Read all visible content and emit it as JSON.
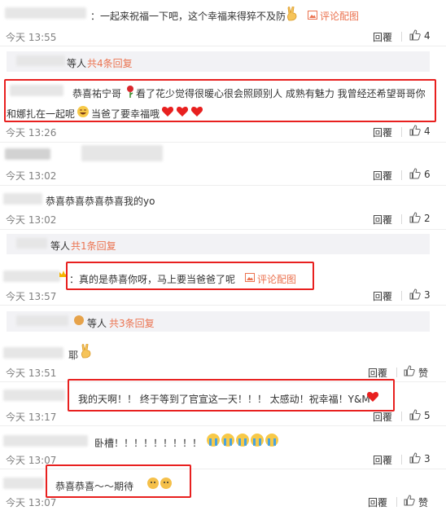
{
  "comments": [
    {
      "text": "：一起来祝福一下吧，这个幸福来得猝不及防",
      "photo_link": "评论配图",
      "time": "今天 13:55",
      "reply": "回覆",
      "likes": "4"
    },
    {
      "text_line1": "恭喜祐宁哥",
      "text_line1b": "看了花少觉得很暖心很会照顾别人 成熟有魅力 我曾经还希望哥哥你",
      "text_line2": "和娜扎在一起呢",
      "text_line2b": "当爸了要幸福哦",
      "time": "今天 13:26",
      "reply": "回覆",
      "likes": "4"
    },
    {
      "time": "今天 13:02",
      "reply": "回覆",
      "likes": "6"
    },
    {
      "text": "恭喜恭喜恭喜恭喜我的yo",
      "time": "今天 13:02",
      "reply": "回覆",
      "likes": "2"
    },
    {
      "text": "：真的是恭喜你呀，马上要当爸爸了呢",
      "photo_link": "评论配图",
      "time": "今天 13:57",
      "reply": "回覆",
      "likes": "3"
    },
    {
      "text": "耶",
      "time": "今天 13:51",
      "reply": "回覆",
      "likes": "赞"
    },
    {
      "text": "我的天啊！！ 终于等到了官宣这一天！！！ 太感动！祝幸福！Y&M",
      "time": "今天 13:17",
      "reply": "回覆",
      "likes": "5"
    },
    {
      "text": "卧槽！！！！！！！！！",
      "time": "今天 13:07",
      "reply": "回覆",
      "likes": "3"
    },
    {
      "text": "恭喜恭喜～～期待",
      "time": "今天 13:07",
      "reply": "回覆",
      "likes": "赞"
    }
  ],
  "subreplies": [
    {
      "label": "等人",
      "link": "共4条回复"
    },
    {
      "label": "等人",
      "link": "共1条回复"
    },
    {
      "label": "等人",
      "link": "共3条回复"
    }
  ],
  "icons": {
    "like": "thumbs-up-icon",
    "photo": "image-icon",
    "rose": "rose-emoji",
    "hearts": "heart-emoji",
    "victory": "victory-hand-emoji",
    "cry": "crying-face-emoji",
    "yeah": "peace-emoji"
  },
  "colors": {
    "link": "#eb7350",
    "highlight_box": "#e8201f",
    "subreply_bg": "#f2f2f5"
  }
}
